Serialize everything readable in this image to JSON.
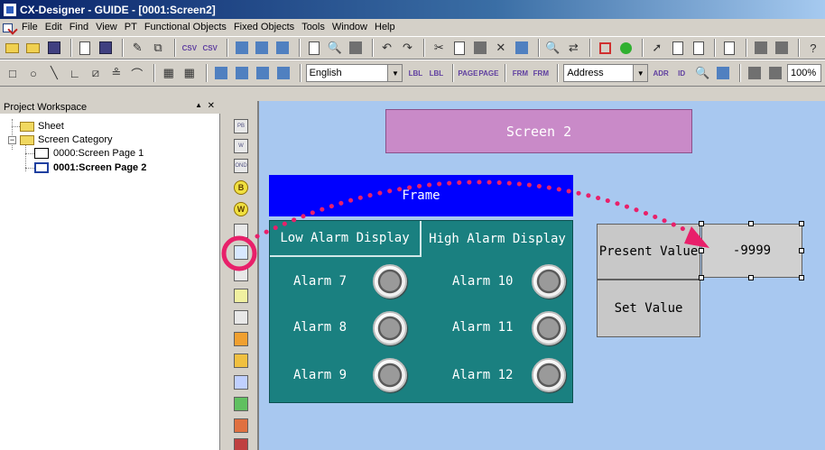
{
  "window": {
    "title": "CX-Designer - GUIDE - [0001:Screen2]"
  },
  "menu": [
    "File",
    "Edit",
    "Find",
    "View",
    "PT",
    "Functional Objects",
    "Fixed Objects",
    "Tools",
    "Window",
    "Help"
  ],
  "toolbar": {
    "language_value": "English",
    "address_value": "Address",
    "zoom_value": "100%",
    "labels": {
      "csv": "CSV",
      "lbl": "LBL",
      "page": "PAGE",
      "frm": "FRM",
      "adr": "ADR",
      "id": "ID"
    }
  },
  "workspace": {
    "title": "Project Workspace",
    "items": [
      {
        "label": "Sheet"
      },
      {
        "label": "Screen Category"
      },
      {
        "label": "0000:Screen Page 1"
      },
      {
        "label": "0001:Screen Page 2"
      }
    ]
  },
  "palette": {
    "items": [
      "PB",
      "W",
      "OND",
      "B",
      "W"
    ]
  },
  "canvas": {
    "screen_label": "Screen 2",
    "frame_label": "Frame",
    "tabs": {
      "low": "Low Alarm Display",
      "high": "High Alarm Display"
    },
    "alarms_left": [
      "Alarm 7",
      "Alarm 8",
      "Alarm 9"
    ],
    "alarms_right": [
      "Alarm 10",
      "Alarm 11",
      "Alarm 12"
    ],
    "present_value_label": "Present Value",
    "set_value_label": "Set Value",
    "display_value": "-9999"
  },
  "colors": {
    "highlight": "#e8206a",
    "frame": "#0000ff",
    "frame_body": "#1a8080",
    "screen_label_bg": "#c98ac8",
    "canvas_bg": "#a8c8f0"
  }
}
